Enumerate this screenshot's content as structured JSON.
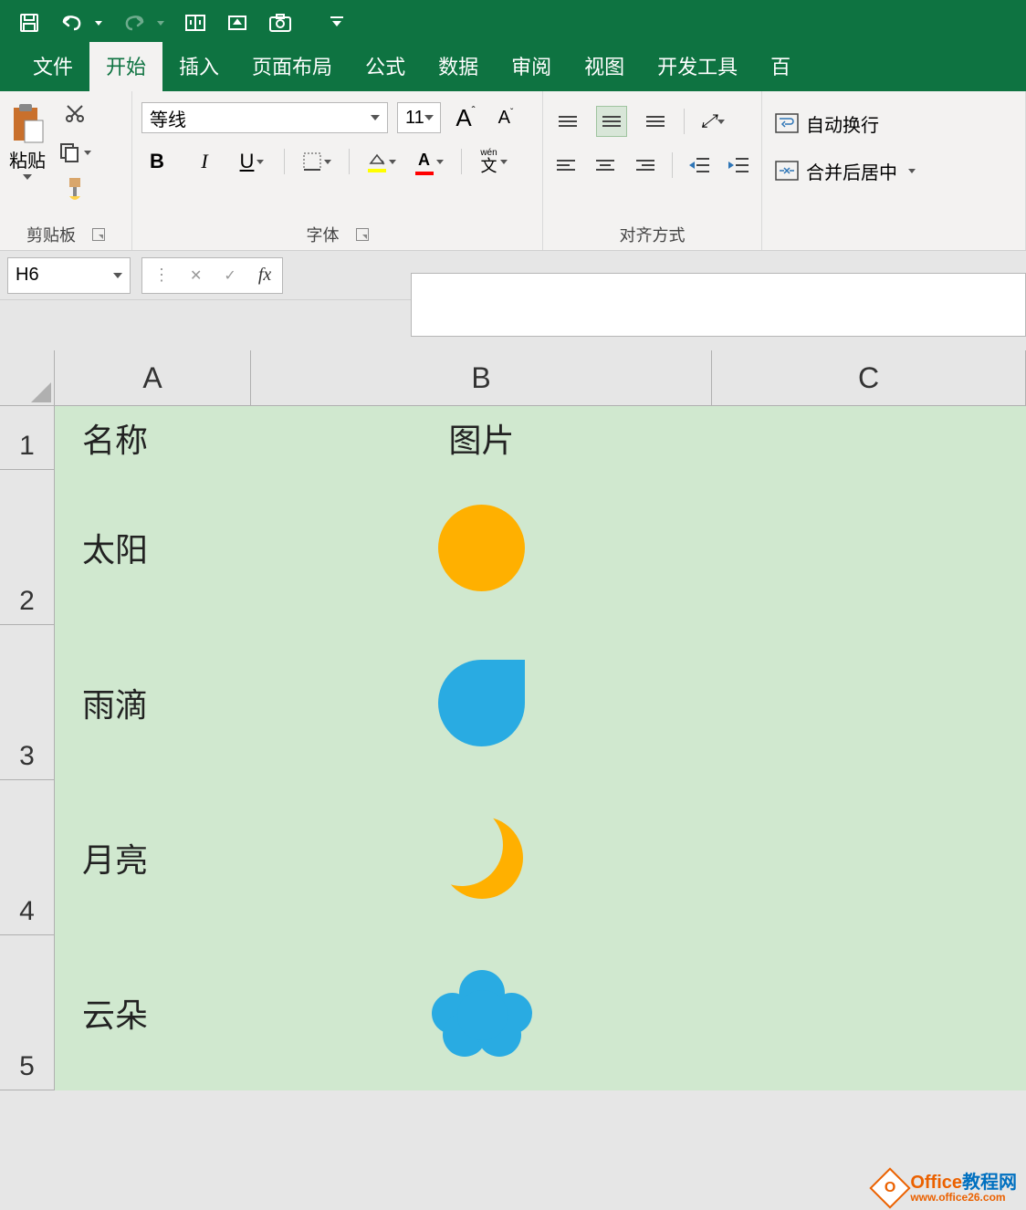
{
  "qat": {
    "save": "save-icon",
    "undo": "undo-icon",
    "redo": "redo-icon"
  },
  "tabs": {
    "file": "文件",
    "home": "开始",
    "insert": "插入",
    "layout": "页面布局",
    "formula": "公式",
    "data": "数据",
    "review": "审阅",
    "view": "视图",
    "developer": "开发工具",
    "more": "百"
  },
  "ribbon": {
    "clipboard": {
      "paste": "粘贴",
      "label": "剪贴板"
    },
    "font": {
      "name": "等线",
      "size": "11",
      "bold": "B",
      "italic": "I",
      "underline": "U",
      "phonetic": "wén",
      "phonetic2": "文",
      "growA": "A",
      "shrinkA": "A",
      "label": "字体"
    },
    "align": {
      "label": "对齐方式"
    },
    "wrap": {
      "wrap": "自动换行",
      "merge": "合并后居中"
    }
  },
  "bar": {
    "namebox": "H6",
    "fx": "fx"
  },
  "grid": {
    "cols": {
      "A": "A",
      "B": "B",
      "C": "C"
    },
    "rows": {
      "r1": "1",
      "r2": "2",
      "r3": "3",
      "r4": "4",
      "r5": "5"
    },
    "headerA": "名称",
    "headerB": "图片",
    "items": [
      {
        "name": "太阳",
        "shape": "sun"
      },
      {
        "name": "雨滴",
        "shape": "drop"
      },
      {
        "name": "月亮",
        "shape": "moon"
      },
      {
        "name": "云朵",
        "shape": "cloud"
      }
    ]
  },
  "watermark": {
    "title_orange": "Office",
    "title_blue": "教程网",
    "url": "www.office26.com"
  }
}
